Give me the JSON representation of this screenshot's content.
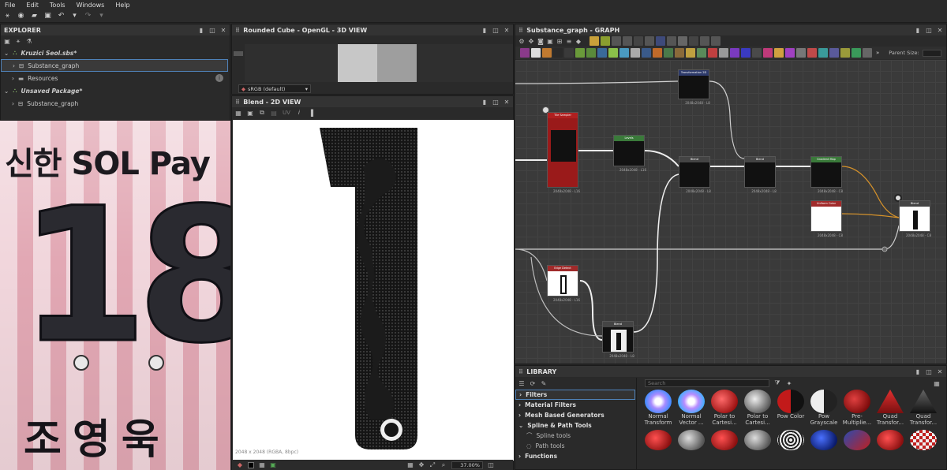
{
  "menu": [
    "File",
    "Edit",
    "Tools",
    "Windows",
    "Help"
  ],
  "explorer": {
    "title": "EXPLORER",
    "package1": "Kruzici Seol.sbs*",
    "graph": "Substance_graph",
    "resources": "Resources",
    "package2": "Unsaved Package*",
    "graph2": "Substance_graph"
  },
  "view3d": {
    "title": "Rounded Cube - OpenGL - 3D VIEW",
    "colorspace": "sRGB (default)"
  },
  "view2d": {
    "title": "Blend - 2D VIEW",
    "status": "2048 x 2048 (RGBA, 8bpc)",
    "zoom": "37.00%",
    "uv": "UV"
  },
  "photo": {
    "sponsor": "신한 SOL Pay",
    "number": "18",
    "name": "조 영 욱"
  },
  "graph": {
    "title": "Substance_graph - GRAPH",
    "parent_size": "Parent Size:",
    "nodes": {
      "transform": {
        "title": "Transformation 2D",
        "res": "2048x2048 - L8"
      },
      "tile_sampler": {
        "title": "Tile Sampler",
        "res": "2048x2048 - L16"
      },
      "levels": {
        "title": "Levels",
        "res": "2048x2048 - L16"
      },
      "blend1": {
        "title": "Blend",
        "res": "2048x2048 - L8"
      },
      "blend2": {
        "title": "Blend",
        "res": "2048x2048 - L8"
      },
      "gradient_map": {
        "title": "Gradient Map",
        "res": "2048x2048 - C8"
      },
      "uniform_color": {
        "title": "Uniform Color",
        "res": "2048x2048 - C8"
      },
      "blend_out": {
        "title": "Blend",
        "res": "2048x2048 - C8"
      },
      "edge_detect": {
        "title": "Edge Detect",
        "res": "2048x2048 - L16"
      },
      "blend3": {
        "title": "Blend",
        "res": "2048x2048 - L8"
      }
    }
  },
  "library": {
    "title": "LIBRARY",
    "search_placeholder": "Search",
    "categories": [
      {
        "label": "Filters",
        "kind": "cat"
      },
      {
        "label": "Material Filters",
        "kind": "cat"
      },
      {
        "label": "Mesh Based Generators",
        "kind": "cat"
      },
      {
        "label": "Spline & Path Tools",
        "kind": "cat"
      },
      {
        "label": "Spline tools",
        "kind": "sub"
      },
      {
        "label": "Path tools",
        "kind": "sub"
      },
      {
        "label": "Functions",
        "kind": "cat"
      }
    ],
    "items": [
      {
        "label": "Normal\nTransform",
        "color": "#7a6cff"
      },
      {
        "label": "Normal\nVector ...",
        "color": "#8f7cff"
      },
      {
        "label": "Polar to\nCartesi...",
        "color": "#c2262a"
      },
      {
        "label": "Polar to\nCartesi...",
        "color": "#8a8a8a"
      },
      {
        "label": "Pow Color",
        "color": "#b01818"
      },
      {
        "label": "Pow\nGrayscale",
        "color": "#888888"
      },
      {
        "label": "Pre-\nMultiplie...",
        "color": "#b82020"
      },
      {
        "label": "Quad\nTransfor...",
        "color": "#c02020"
      },
      {
        "label": "Quad\nTransfor...",
        "color": "#666666"
      }
    ],
    "row2": [
      "#a81a1a",
      "#777777",
      "#b21c1c",
      "#858585",
      "#999999",
      "#1a3a9a",
      "#2040a0",
      "#b81e1e",
      "#c0c0c0"
    ]
  }
}
